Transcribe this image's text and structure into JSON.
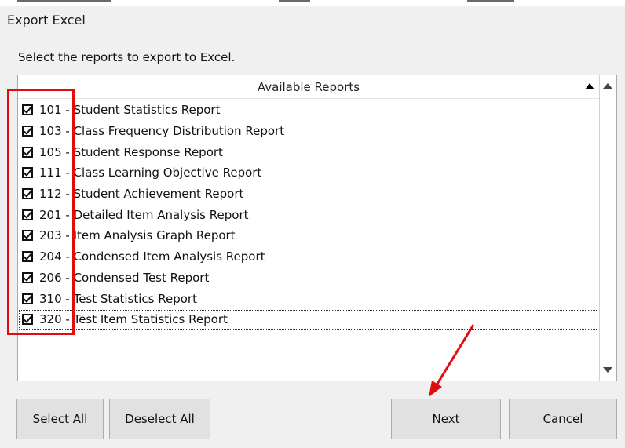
{
  "window": {
    "title": "Export Excel"
  },
  "instruction": "Select the reports to export to Excel.",
  "list": {
    "header": "Available Reports",
    "items": [
      {
        "label": "101 - Student Statistics Report",
        "checked": true
      },
      {
        "label": "103 - Class Frequency Distribution Report",
        "checked": true
      },
      {
        "label": "105 - Student Response Report",
        "checked": true
      },
      {
        "label": "111 - Class Learning Objective Report",
        "checked": true
      },
      {
        "label": "112 - Student Achievement Report",
        "checked": true
      },
      {
        "label": "201 - Detailed Item Analysis Report",
        "checked": true
      },
      {
        "label": "203 - Item Analysis Graph Report",
        "checked": true
      },
      {
        "label": "204 - Condensed Item Analysis Report",
        "checked": true
      },
      {
        "label": "206 - Condensed Test Report",
        "checked": true
      },
      {
        "label": "310 - Test Statistics Report",
        "checked": true
      },
      {
        "label": "320 - Test Item Statistics Report",
        "checked": true
      }
    ]
  },
  "buttons": {
    "select_all": "Select All",
    "deselect_all": "Deselect All",
    "next": "Next",
    "cancel": "Cancel"
  },
  "colors": {
    "annotation": "#e00d0d",
    "button_face": "#e1e1e1",
    "window_bg": "#f0f0f0"
  },
  "icons": {
    "sort": "sort-ascending-icon",
    "scroll_up": "scroll-up-arrow-icon",
    "scroll_down": "scroll-down-arrow-icon",
    "checkbox": "checkbox-checked-icon"
  }
}
